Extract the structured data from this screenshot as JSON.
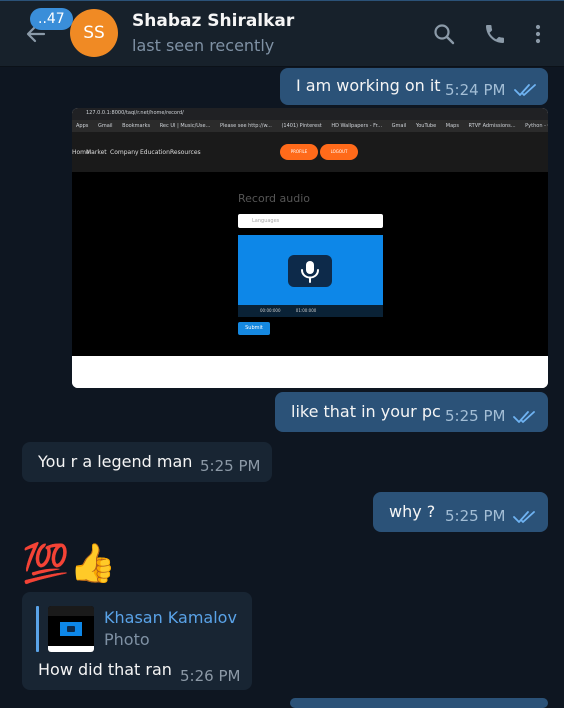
{
  "header": {
    "unread_badge": "..47",
    "avatar_initials": "SS",
    "avatar_color": "#f08a24",
    "contact_name": "Shabaz Shiralkar",
    "status": "last seen recently",
    "icons": [
      "back-arrow-icon",
      "search-icon",
      "phone-icon",
      "more-vert-icon"
    ]
  },
  "messages": [
    {
      "direction": "out",
      "text": "I am working on it",
      "time": "5:24 PM",
      "read": true
    },
    {
      "direction": "out",
      "type": "photo",
      "caption": "like that in your pc",
      "time": "5:25 PM",
      "read": true
    },
    {
      "direction": "in",
      "text": "You r a legend man",
      "time": "5:25 PM"
    },
    {
      "direction": "out",
      "text": "why ?",
      "time": "5:25 PM",
      "read": true
    },
    {
      "direction": "in",
      "type": "emoji",
      "text": "💯👍"
    },
    {
      "direction": "in",
      "reply_to": {
        "name": "Khasan Kamalov",
        "type": "Photo"
      },
      "text": "How did that ran",
      "time": "5:26 PM"
    }
  ],
  "screenshot": {
    "url": "127.0.0.1:8000/taqi/r.net/home/record/",
    "bookmarks": [
      "Apps",
      "Gmail",
      "Bookmarks",
      "Rec UI | Music/Use...",
      "Please see http://w...",
      "(1401) Pinterest",
      "HD Wallpapers - Fr...",
      "Gmail",
      "YouTube",
      "Maps",
      "RTVF Admissions...",
      "Python - CU"
    ],
    "nav_links": [
      "Home",
      "Market",
      "Company",
      "Education",
      "Resources"
    ],
    "nav_buttons": [
      "PROFILE",
      "LOGOUT"
    ],
    "title": "Record audio",
    "field_placeholder": "Languages",
    "player_times": [
      "00:00:000",
      "01:00:000"
    ],
    "submit_label": "Submit"
  },
  "colors": {
    "background": "#0e1621",
    "header": "#17212b",
    "outgoing_bubble": "#2b5278",
    "incoming_bubble": "#182533",
    "accent": "#5aa3e8"
  }
}
